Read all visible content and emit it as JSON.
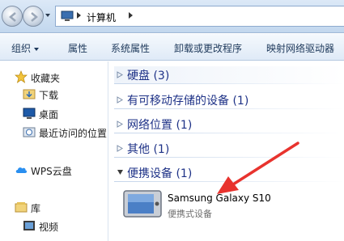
{
  "window": {
    "breadcrumb": [
      "计算机"
    ]
  },
  "commands": [
    {
      "label": "组织",
      "has_dropdown": true
    },
    {
      "label": "属性"
    },
    {
      "label": "系统属性"
    },
    {
      "label": "卸载或更改程序"
    },
    {
      "label": "映射网络驱动器"
    }
  ],
  "nav": {
    "items": [
      {
        "label": "收藏夹",
        "icon": "star-icon"
      },
      {
        "label": "下载",
        "icon": "download-folder-icon"
      },
      {
        "label": "桌面",
        "icon": "desktop-icon"
      },
      {
        "label": "最近访问的位置",
        "icon": "recent-places-icon"
      },
      {
        "label": "WPS云盘",
        "icon": "cloud-icon"
      },
      {
        "label": "库",
        "icon": "library-icon"
      },
      {
        "label": "视频",
        "icon": "video-icon"
      }
    ]
  },
  "groups": [
    {
      "title": "硬盘 (3)",
      "expanded": false
    },
    {
      "title": "有可移动存储的设备 (1)",
      "expanded": false
    },
    {
      "title": "网络位置 (1)",
      "expanded": false
    },
    {
      "title": "其他 (1)",
      "expanded": false
    },
    {
      "title": "便携设备 (1)",
      "expanded": true
    }
  ],
  "device": {
    "name": "Samsung Galaxy S10",
    "type": "便携式设备",
    "icon": "portable-device-icon"
  },
  "colors": {
    "annotation_arrow": "#e8332e",
    "group_title": "#1e3287"
  }
}
